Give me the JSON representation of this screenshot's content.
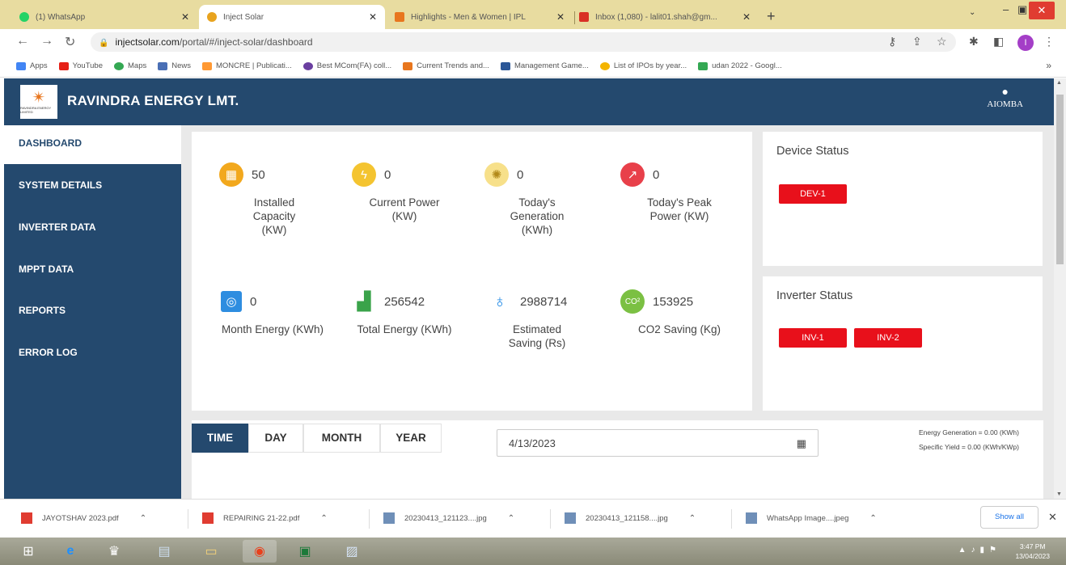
{
  "browser": {
    "tabs": [
      {
        "title": "(1) WhatsApp",
        "color": "#25d366"
      },
      {
        "title": "Inject Solar",
        "color": "#e8a31e"
      },
      {
        "title": "Highlights - Men & Women | IPL",
        "color": "#e8761e"
      },
      {
        "title": "Inbox (1,080) - lalit01.shah@gm...",
        "color": "#d93025"
      }
    ],
    "new_tab": "+",
    "url_host": "injectsolar.com",
    "url_path": "/portal/#/inject-solar/dashboard",
    "profile_initial": "I",
    "bookmarks": [
      {
        "label": "Apps",
        "color": "#4285f4"
      },
      {
        "label": "YouTube",
        "color": "#e62117"
      },
      {
        "label": "Maps",
        "color": "#34a853"
      },
      {
        "label": "News",
        "color": "#4a6fb5"
      },
      {
        "label": "MONCRE | Publicati...",
        "color": "#ff9933"
      },
      {
        "label": "Best MCom(FA) coll...",
        "color": "#6a3fa0"
      },
      {
        "label": "Current Trends and...",
        "color": "#e8761e"
      },
      {
        "label": "Management Game...",
        "color": "#2b5797"
      },
      {
        "label": "List of IPOs by year...",
        "color": "#f4b400"
      },
      {
        "label": "udan 2022 - Googl...",
        "color": "#34a853"
      }
    ]
  },
  "app": {
    "brand": "RAVINDRA ENERGY LMT.",
    "user": "AIOMBA",
    "logo_text": "RAVINDRA ENERGY LIMITED"
  },
  "sidebar": {
    "items": [
      {
        "label": "DASHBOARD"
      },
      {
        "label": "SYSTEM DETAILS"
      },
      {
        "label": "INVERTER DATA"
      },
      {
        "label": "MPPT DATA"
      },
      {
        "label": "REPORTS"
      },
      {
        "label": "ERROR LOG"
      }
    ]
  },
  "stats": [
    {
      "value": "50",
      "label": "Installed Capacity (KW)",
      "icon": "solar-panel-icon",
      "color": "#f2a81d"
    },
    {
      "value": "0",
      "label": "Current Power (KW)",
      "icon": "lightning-icon",
      "color": "#f4c430"
    },
    {
      "value": "0",
      "label": "Today's Generation (KWh)",
      "icon": "generation-icon",
      "color": "#f7e08a"
    },
    {
      "value": "0",
      "label": "Today's Peak Power (KW)",
      "icon": "peak-power-icon",
      "color": "#e8404a"
    },
    {
      "value": "0",
      "label": "Month Energy (KWh)",
      "icon": "calendar-energy-icon",
      "color": "#2e8de0"
    },
    {
      "value": "256542",
      "label": "Total Energy (KWh)",
      "icon": "bar-chart-icon",
      "color": "#3aa34a"
    },
    {
      "value": "2988714",
      "label": "Estimated Saving (Rs)",
      "icon": "savings-icon",
      "color": "#1e88e5"
    },
    {
      "value": "153925",
      "label": "CO2 Saving (Kg)",
      "icon": "co2-icon",
      "color": "#7bc043"
    }
  ],
  "device_status": {
    "title": "Device Status",
    "badges": [
      "DEV-1"
    ],
    "badge_color": "#e8101b"
  },
  "inverter_status": {
    "title": "Inverter Status",
    "badges": [
      "INV-1",
      "INV-2"
    ],
    "badge_color": "#e8101b"
  },
  "filter": {
    "tabs": [
      "TIME",
      "DAY",
      "MONTH",
      "YEAR"
    ],
    "active_tab": "TIME",
    "date": "4/13/2023",
    "energy_generation": "Energy Generation = 0.00 (KWh)",
    "specific_yield": "Specific Yield = 0.00 (KWh/KWp)"
  },
  "downloads": {
    "files": [
      "JAYOTSHAV 2023.pdf",
      "REPAIRING 21-22.pdf",
      "20230413_121123....jpg",
      "20230413_121158....jpg",
      "WhatsApp Image....jpeg"
    ],
    "show_all": "Show all"
  },
  "taskbar": {
    "time": "3:47 PM",
    "date": "13/04/2023"
  }
}
